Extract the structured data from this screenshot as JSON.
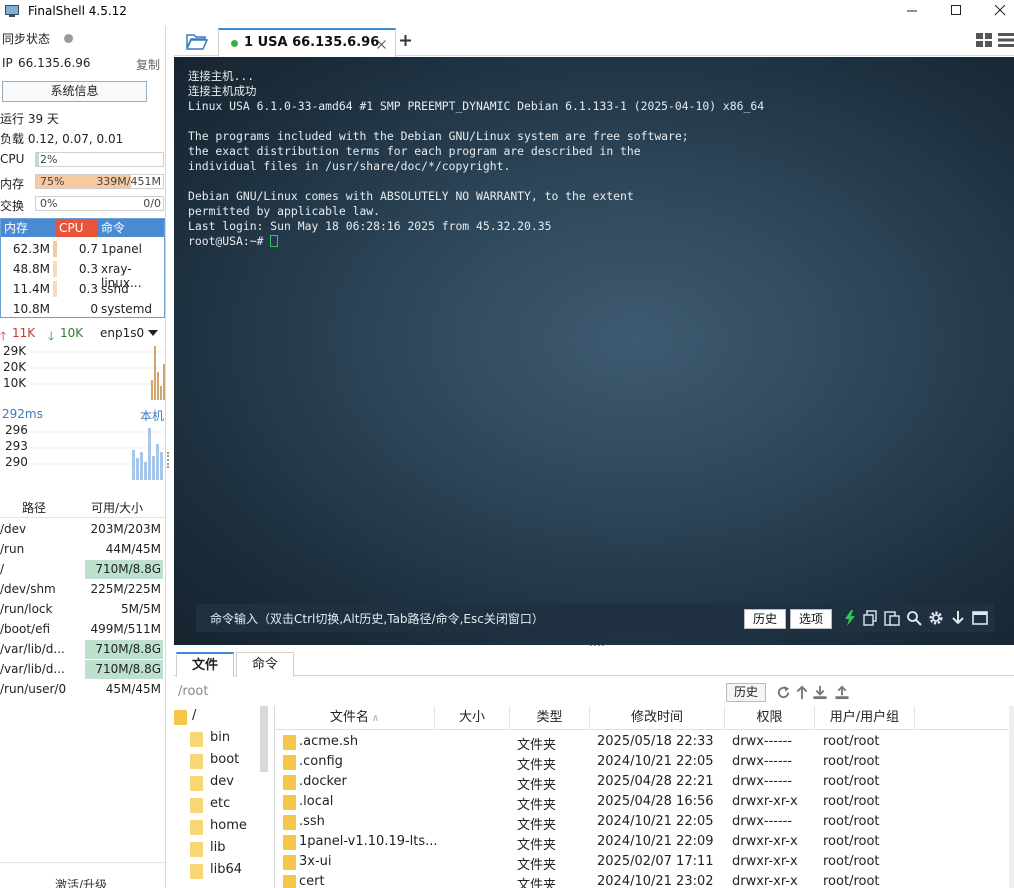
{
  "window": {
    "title": "FinalShell 4.5.12",
    "icon": "terminal-app-icon",
    "controls": [
      "minimize",
      "maximize",
      "close"
    ]
  },
  "sidebar": {
    "sync_label": "同步状态",
    "ip_label": "IP",
    "ip_value": "66.135.6.96",
    "copy_label": "复制",
    "sysinfo_button": "系统信息",
    "uptime": "运行 39 天",
    "load": "负载 0.12, 0.07, 0.01",
    "cpu": {
      "label": "CPU",
      "text": "2%",
      "fraction": 0.02
    },
    "mem": {
      "label": "内存",
      "text": "75%",
      "value": "339M/451M",
      "fraction": 0.75
    },
    "swap": {
      "label": "交换",
      "text": "0%",
      "value": "0/0",
      "fraction": 0
    },
    "process_table": {
      "headers": [
        "内存",
        "CPU",
        "命令"
      ],
      "rows": [
        {
          "mem": "62.3M",
          "cpu": "0.7",
          "cmd": "1panel",
          "cpu_level": 0.7
        },
        {
          "mem": "48.8M",
          "cpu": "0.3",
          "cmd": "xray-linux...",
          "cpu_level": 0.3
        },
        {
          "mem": "11.4M",
          "cpu": "0.3",
          "cmd": "sshd",
          "cpu_level": 0.3
        },
        {
          "mem": "10.8M",
          "cpu": "0",
          "cmd": "systemd",
          "cpu_level": 0
        }
      ]
    },
    "network": {
      "up": "11K",
      "down": "10K",
      "interface": "enp1s0",
      "ticks": [
        "29K",
        "20K",
        "10K"
      ]
    },
    "latency": {
      "value": "292ms",
      "target": "本机",
      "ticks": [
        "296",
        "293",
        "290"
      ]
    },
    "disk_table": {
      "headers": [
        "路径",
        "可用/大小"
      ],
      "rows": [
        {
          "path": "/dev",
          "size": "203M/203M",
          "highlight": false
        },
        {
          "path": "/run",
          "size": "44M/45M",
          "highlight": false
        },
        {
          "path": "/",
          "size": "710M/8.8G",
          "highlight": true
        },
        {
          "path": "/dev/shm",
          "size": "225M/225M",
          "highlight": false
        },
        {
          "path": "/run/lock",
          "size": "5M/5M",
          "highlight": false
        },
        {
          "path": "/boot/efi",
          "size": "499M/511M",
          "highlight": false
        },
        {
          "path": "/var/lib/d...",
          "size": "710M/8.8G",
          "highlight": true
        },
        {
          "path": "/var/lib/d...",
          "size": "710M/8.8G",
          "highlight": true
        },
        {
          "path": "/run/user/0",
          "size": "45M/45M",
          "highlight": false
        }
      ]
    },
    "activate": "激活/升级"
  },
  "tabs": {
    "active_label": "1 USA 66.135.6.96",
    "status_color": "#2fb44a"
  },
  "terminal": {
    "lines": [
      "连接主机...",
      "连接主机成功",
      "Linux USA 6.1.0-33-amd64 #1 SMP PREEMPT_DYNAMIC Debian 6.1.133-1 (2025-04-10) x86_64",
      "",
      "The programs included with the Debian GNU/Linux system are free software;",
      "the exact distribution terms for each program are described in the",
      "individual files in /usr/share/doc/*/copyright.",
      "",
      "Debian GNU/Linux comes with ABSOLUTELY NO WARRANTY, to the extent",
      "permitted by applicable law.",
      "Last login: Sun May 18 06:28:16 2025 from 45.32.20.35"
    ],
    "prompt": "root@USA:~# ",
    "command_hint": "命令输入（双击Ctrl切换,Alt历史,Tab路径/命令,Esc关闭窗口）",
    "history_button": "历史",
    "options_button": "选项"
  },
  "file_manager": {
    "tabs": [
      "文件",
      "命令"
    ],
    "path": "/root",
    "history_button": "历史",
    "tree": [
      {
        "name": "/"
      },
      {
        "name": "bin"
      },
      {
        "name": "boot"
      },
      {
        "name": "dev"
      },
      {
        "name": "etc"
      },
      {
        "name": "home"
      },
      {
        "name": "lib"
      },
      {
        "name": "lib64"
      }
    ],
    "columns": [
      "文件名",
      "大小",
      "类型",
      "修改时间",
      "权限",
      "用户/用户组"
    ],
    "files": [
      {
        "name": ".acme.sh",
        "size": "",
        "type": "文件夹",
        "modified": "2025/05/18 22:33",
        "perm": "drwx------",
        "owner": "root/root"
      },
      {
        "name": ".config",
        "size": "",
        "type": "文件夹",
        "modified": "2024/10/21 22:05",
        "perm": "drwx------",
        "owner": "root/root"
      },
      {
        "name": ".docker",
        "size": "",
        "type": "文件夹",
        "modified": "2025/04/28 22:21",
        "perm": "drwx------",
        "owner": "root/root"
      },
      {
        "name": ".local",
        "size": "",
        "type": "文件夹",
        "modified": "2025/04/28 16:56",
        "perm": "drwxr-xr-x",
        "owner": "root/root"
      },
      {
        "name": ".ssh",
        "size": "",
        "type": "文件夹",
        "modified": "2024/10/21 22:05",
        "perm": "drwx------",
        "owner": "root/root"
      },
      {
        "name": "1panel-v1.10.19-lts...",
        "size": "",
        "type": "文件夹",
        "modified": "2024/10/21 22:09",
        "perm": "drwxr-xr-x",
        "owner": "root/root"
      },
      {
        "name": "3x-ui",
        "size": "",
        "type": "文件夹",
        "modified": "2025/02/07 17:11",
        "perm": "drwxr-xr-x",
        "owner": "root/root"
      },
      {
        "name": "cert",
        "size": "",
        "type": "文件夹",
        "modified": "2024/10/21 23:02",
        "perm": "drwxr-xr-x",
        "owner": "root/root"
      }
    ]
  },
  "colors": {
    "accent": "#3d8ad8",
    "mem_fill": "#f6c9a0",
    "cpu_header": "#e8543a",
    "mem_header": "#4b8ad2",
    "disk_highlight": "#bde0cf",
    "folder": "#f5c64a"
  }
}
